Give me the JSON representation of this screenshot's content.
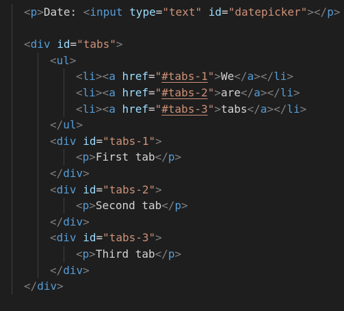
{
  "editor": {
    "lines": [
      {
        "indent": 1,
        "tokens": [
          {
            "t": "<",
            "c": "bracket"
          },
          {
            "t": "p",
            "c": "tag"
          },
          {
            "t": ">",
            "c": "bracket"
          },
          {
            "t": "Date: ",
            "c": "txt"
          },
          {
            "t": "<",
            "c": "bracket"
          },
          {
            "t": "input",
            "c": "tag"
          },
          {
            "t": " ",
            "c": "txt"
          },
          {
            "t": "type",
            "c": "attr"
          },
          {
            "t": "=",
            "c": "eq"
          },
          {
            "t": "\"text\"",
            "c": "str"
          },
          {
            "t": " ",
            "c": "txt"
          },
          {
            "t": "id",
            "c": "attr"
          },
          {
            "t": "=",
            "c": "eq"
          },
          {
            "t": "\"datepicker\"",
            "c": "str"
          },
          {
            "t": ">",
            "c": "bracket"
          },
          {
            "t": "</",
            "c": "bracket"
          },
          {
            "t": "p",
            "c": "tag"
          },
          {
            "t": ">",
            "c": "bracket"
          }
        ]
      },
      {
        "indent": 1,
        "tokens": []
      },
      {
        "indent": 1,
        "tokens": [
          {
            "t": "<",
            "c": "bracket"
          },
          {
            "t": "div",
            "c": "tag"
          },
          {
            "t": " ",
            "c": "txt"
          },
          {
            "t": "id",
            "c": "attr"
          },
          {
            "t": "=",
            "c": "eq"
          },
          {
            "t": "\"tabs\"",
            "c": "str"
          },
          {
            "t": ">",
            "c": "bracket"
          }
        ]
      },
      {
        "indent": 2,
        "tokens": [
          {
            "t": "<",
            "c": "bracket"
          },
          {
            "t": "ul",
            "c": "tag"
          },
          {
            "t": ">",
            "c": "bracket"
          }
        ]
      },
      {
        "indent": 3,
        "tokens": [
          {
            "t": "<",
            "c": "bracket"
          },
          {
            "t": "li",
            "c": "tag"
          },
          {
            "t": ">",
            "c": "bracket"
          },
          {
            "t": "<",
            "c": "bracket"
          },
          {
            "t": "a",
            "c": "tag"
          },
          {
            "t": " ",
            "c": "txt"
          },
          {
            "t": "href",
            "c": "attr"
          },
          {
            "t": "=",
            "c": "eq"
          },
          {
            "t": "\"",
            "c": "str"
          },
          {
            "t": "#tabs-1",
            "c": "str-link"
          },
          {
            "t": "\"",
            "c": "str"
          },
          {
            "t": ">",
            "c": "bracket"
          },
          {
            "t": "We",
            "c": "txt"
          },
          {
            "t": "</",
            "c": "bracket"
          },
          {
            "t": "a",
            "c": "tag"
          },
          {
            "t": ">",
            "c": "bracket"
          },
          {
            "t": "</",
            "c": "bracket"
          },
          {
            "t": "li",
            "c": "tag"
          },
          {
            "t": ">",
            "c": "bracket"
          }
        ]
      },
      {
        "indent": 3,
        "tokens": [
          {
            "t": "<",
            "c": "bracket"
          },
          {
            "t": "li",
            "c": "tag"
          },
          {
            "t": ">",
            "c": "bracket"
          },
          {
            "t": "<",
            "c": "bracket"
          },
          {
            "t": "a",
            "c": "tag"
          },
          {
            "t": " ",
            "c": "txt"
          },
          {
            "t": "href",
            "c": "attr"
          },
          {
            "t": "=",
            "c": "eq"
          },
          {
            "t": "\"",
            "c": "str"
          },
          {
            "t": "#tabs-2",
            "c": "str-link"
          },
          {
            "t": "\"",
            "c": "str"
          },
          {
            "t": ">",
            "c": "bracket"
          },
          {
            "t": "are",
            "c": "txt"
          },
          {
            "t": "</",
            "c": "bracket"
          },
          {
            "t": "a",
            "c": "tag"
          },
          {
            "t": ">",
            "c": "bracket"
          },
          {
            "t": "</",
            "c": "bracket"
          },
          {
            "t": "li",
            "c": "tag"
          },
          {
            "t": ">",
            "c": "bracket"
          }
        ]
      },
      {
        "indent": 3,
        "tokens": [
          {
            "t": "<",
            "c": "bracket"
          },
          {
            "t": "li",
            "c": "tag"
          },
          {
            "t": ">",
            "c": "bracket"
          },
          {
            "t": "<",
            "c": "bracket"
          },
          {
            "t": "a",
            "c": "tag"
          },
          {
            "t": " ",
            "c": "txt"
          },
          {
            "t": "href",
            "c": "attr"
          },
          {
            "t": "=",
            "c": "eq"
          },
          {
            "t": "\"",
            "c": "str"
          },
          {
            "t": "#tabs-3",
            "c": "str-link"
          },
          {
            "t": "\"",
            "c": "str"
          },
          {
            "t": ">",
            "c": "bracket"
          },
          {
            "t": "tabs",
            "c": "txt"
          },
          {
            "t": "</",
            "c": "bracket"
          },
          {
            "t": "a",
            "c": "tag"
          },
          {
            "t": ">",
            "c": "bracket"
          },
          {
            "t": "</",
            "c": "bracket"
          },
          {
            "t": "li",
            "c": "tag"
          },
          {
            "t": ">",
            "c": "bracket"
          }
        ]
      },
      {
        "indent": 2,
        "tokens": [
          {
            "t": "</",
            "c": "bracket"
          },
          {
            "t": "ul",
            "c": "tag"
          },
          {
            "t": ">",
            "c": "bracket"
          }
        ]
      },
      {
        "indent": 2,
        "tokens": [
          {
            "t": "<",
            "c": "bracket"
          },
          {
            "t": "div",
            "c": "tag"
          },
          {
            "t": " ",
            "c": "txt"
          },
          {
            "t": "id",
            "c": "attr"
          },
          {
            "t": "=",
            "c": "eq"
          },
          {
            "t": "\"tabs-1\"",
            "c": "str"
          },
          {
            "t": ">",
            "c": "bracket"
          }
        ]
      },
      {
        "indent": 3,
        "tokens": [
          {
            "t": "<",
            "c": "bracket"
          },
          {
            "t": "p",
            "c": "tag"
          },
          {
            "t": ">",
            "c": "bracket"
          },
          {
            "t": "First tab",
            "c": "txt"
          },
          {
            "t": "</",
            "c": "bracket"
          },
          {
            "t": "p",
            "c": "tag"
          },
          {
            "t": ">",
            "c": "bracket"
          }
        ]
      },
      {
        "indent": 2,
        "tokens": [
          {
            "t": "</",
            "c": "bracket"
          },
          {
            "t": "div",
            "c": "tag"
          },
          {
            "t": ">",
            "c": "bracket"
          }
        ]
      },
      {
        "indent": 2,
        "tokens": [
          {
            "t": "<",
            "c": "bracket"
          },
          {
            "t": "div",
            "c": "tag"
          },
          {
            "t": " ",
            "c": "txt"
          },
          {
            "t": "id",
            "c": "attr"
          },
          {
            "t": "=",
            "c": "eq"
          },
          {
            "t": "\"tabs-2\"",
            "c": "str"
          },
          {
            "t": ">",
            "c": "bracket"
          }
        ]
      },
      {
        "indent": 3,
        "tokens": [
          {
            "t": "<",
            "c": "bracket"
          },
          {
            "t": "p",
            "c": "tag"
          },
          {
            "t": ">",
            "c": "bracket"
          },
          {
            "t": "Second tab",
            "c": "txt"
          },
          {
            "t": "</",
            "c": "bracket"
          },
          {
            "t": "p",
            "c": "tag"
          },
          {
            "t": ">",
            "c": "bracket"
          }
        ]
      },
      {
        "indent": 2,
        "tokens": [
          {
            "t": "</",
            "c": "bracket"
          },
          {
            "t": "div",
            "c": "tag"
          },
          {
            "t": ">",
            "c": "bracket"
          }
        ]
      },
      {
        "indent": 2,
        "tokens": [
          {
            "t": "<",
            "c": "bracket"
          },
          {
            "t": "div",
            "c": "tag"
          },
          {
            "t": " ",
            "c": "txt"
          },
          {
            "t": "id",
            "c": "attr"
          },
          {
            "t": "=",
            "c": "eq"
          },
          {
            "t": "\"tabs-3\"",
            "c": "str"
          },
          {
            "t": ">",
            "c": "bracket"
          }
        ]
      },
      {
        "indent": 3,
        "tokens": [
          {
            "t": "<",
            "c": "bracket"
          },
          {
            "t": "p",
            "c": "tag"
          },
          {
            "t": ">",
            "c": "bracket"
          },
          {
            "t": "Third tab",
            "c": "txt"
          },
          {
            "t": "</",
            "c": "bracket"
          },
          {
            "t": "p",
            "c": "tag"
          },
          {
            "t": ">",
            "c": "bracket"
          }
        ]
      },
      {
        "indent": 2,
        "tokens": [
          {
            "t": "</",
            "c": "bracket"
          },
          {
            "t": "div",
            "c": "tag"
          },
          {
            "t": ">",
            "c": "bracket"
          }
        ]
      },
      {
        "indent": 1,
        "tokens": [
          {
            "t": "</",
            "c": "bracket"
          },
          {
            "t": "div",
            "c": "tag"
          },
          {
            "t": ">",
            "c": "bracket"
          }
        ]
      }
    ]
  },
  "colors": {
    "background": "#1e1e1e",
    "tag": "#569cd6",
    "attribute": "#9cdcfe",
    "string": "#ce9178",
    "bracket": "#808080",
    "text": "#d4d4d4",
    "indent_guide": "#404040"
  }
}
